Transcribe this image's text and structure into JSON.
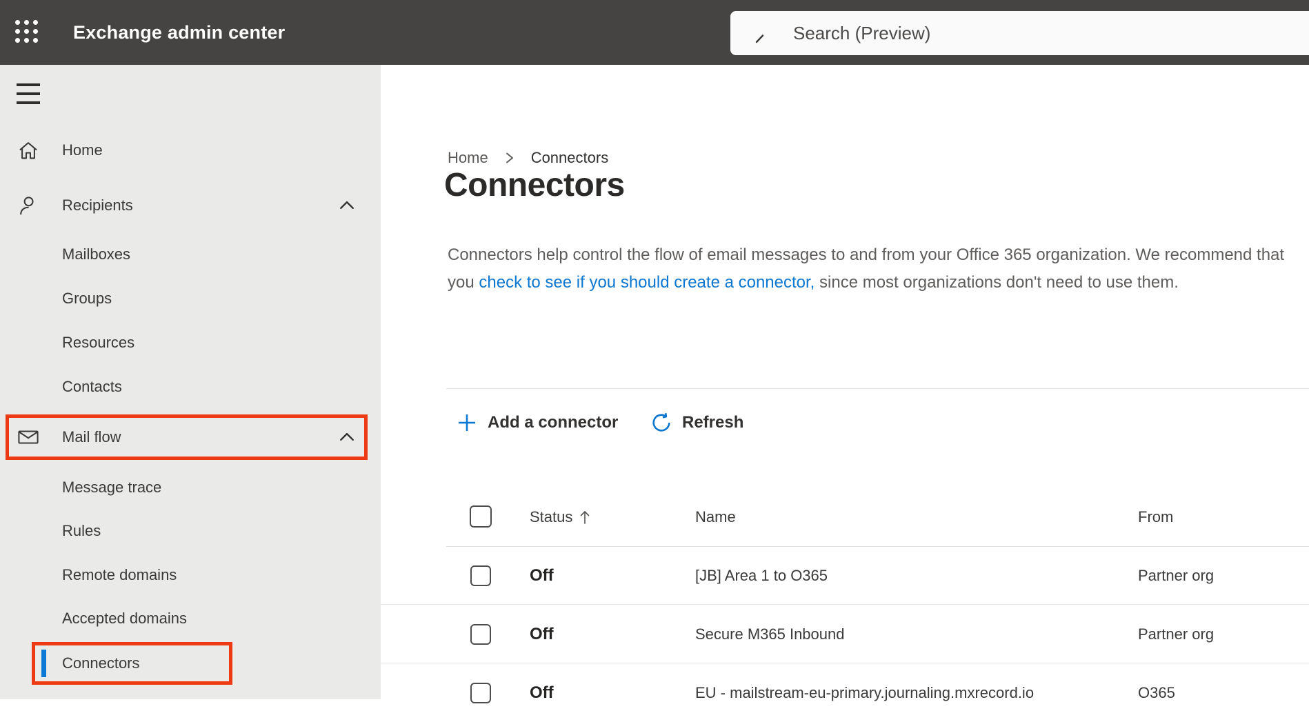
{
  "header": {
    "app_title": "Exchange admin center",
    "search_placeholder": "Search (Preview)"
  },
  "sidebar": {
    "items": [
      {
        "label": "Home"
      },
      {
        "label": "Recipients"
      },
      {
        "label": "Mailboxes"
      },
      {
        "label": "Groups"
      },
      {
        "label": "Resources"
      },
      {
        "label": "Contacts"
      },
      {
        "label": "Mail flow"
      },
      {
        "label": "Message trace"
      },
      {
        "label": "Rules"
      },
      {
        "label": "Remote domains"
      },
      {
        "label": "Accepted domains"
      },
      {
        "label": "Connectors"
      }
    ]
  },
  "breadcrumb": {
    "home": "Home",
    "current": "Connectors"
  },
  "main": {
    "title": "Connectors",
    "description_before": "Connectors help control the flow of email messages to and from your Office 365 organization. We recommend that you ",
    "description_link": "check to see if you should create a connector,",
    "description_after": " since most organizations don't need to use them.",
    "toolbar": {
      "add_label": "Add a connector",
      "refresh_label": "Refresh"
    },
    "table": {
      "columns": [
        "Status",
        "Name",
        "From"
      ],
      "rows": [
        {
          "status": "Off",
          "name": "[JB] Area 1 to O365",
          "from": "Partner org"
        },
        {
          "status": "Off",
          "name": "Secure M365 Inbound",
          "from": "Partner org"
        },
        {
          "status": "Off",
          "name": "EU - mailstream-eu-primary.journaling.mxrecord.io",
          "from": "O365"
        }
      ]
    }
  },
  "colors": {
    "accent": "#0b77d0",
    "annotation": "#ee3a14",
    "selected_bar": "#0b7ad4",
    "topbar": "#454442"
  }
}
